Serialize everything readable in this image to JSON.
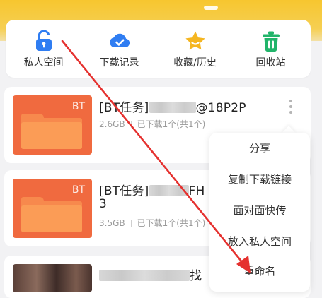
{
  "quick_actions": [
    {
      "label": "私人空间",
      "icon": "lock-open-icon",
      "color": "#2f7df2"
    },
    {
      "label": "下载记录",
      "icon": "check-cloud-icon",
      "color": "#2f7df2"
    },
    {
      "label": "收藏/历史",
      "icon": "star-icon",
      "color": "#f5b621"
    },
    {
      "label": "回收站",
      "icon": "trash-icon",
      "color": "#21b46a"
    }
  ],
  "files": [
    {
      "thumb_tag": "BT",
      "title_prefix": "[BT任务]",
      "title_suffix": "@18P2P",
      "title_line2": "",
      "size": "2.6GB",
      "status": "已下载1个(共1个)"
    },
    {
      "thumb_tag": "BT",
      "title_prefix": "[BT任务]",
      "title_suffix": "FH",
      "title_line2": "3",
      "size": "3.5GB",
      "status": "已下载1个(共1个)"
    },
    {
      "title_suffix": "找"
    }
  ],
  "context_menu": {
    "items": [
      "分享",
      "复制下载链接",
      "面对面快传",
      "放入私人空间",
      "重命名"
    ]
  },
  "colors": {
    "accent_yellow": "#f7c62f",
    "bt_orange": "#f06a3f",
    "annotation_red": "#e5312f"
  }
}
